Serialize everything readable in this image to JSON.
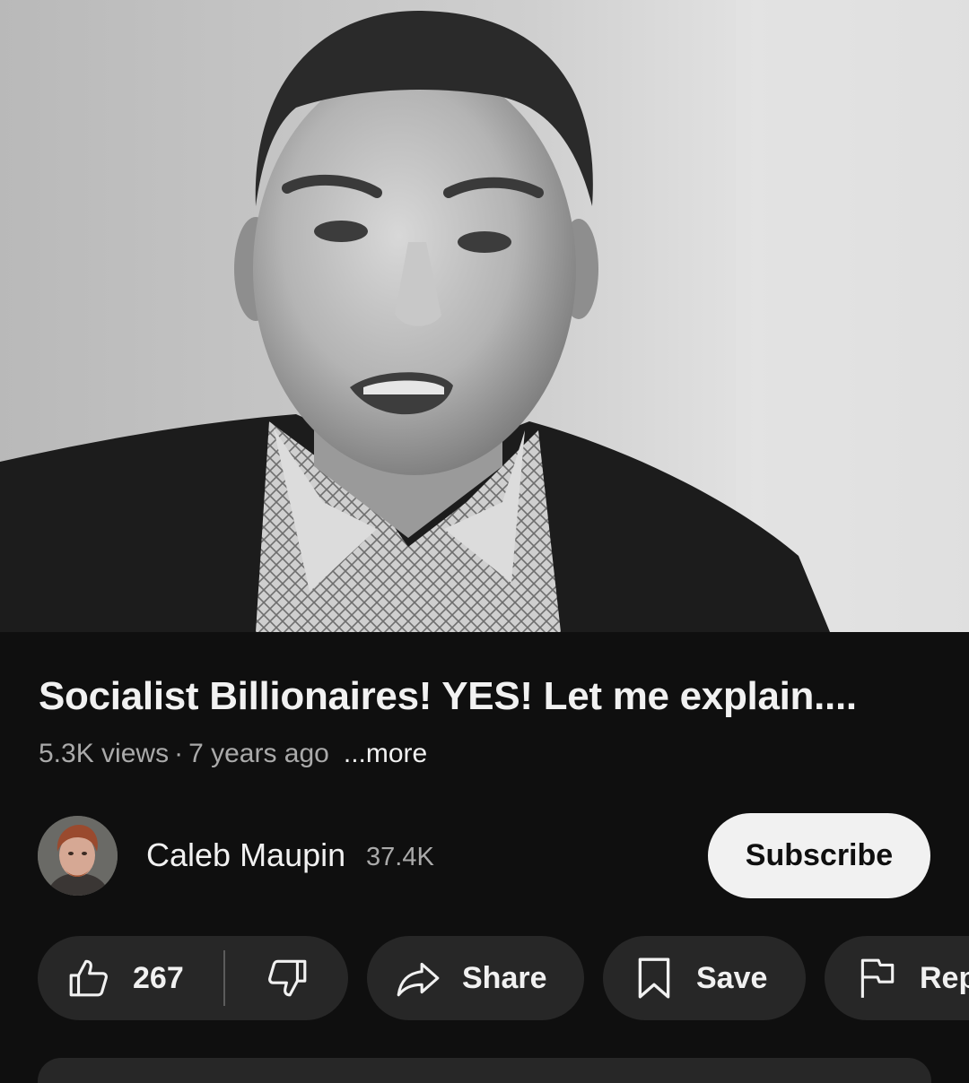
{
  "video": {
    "title": "Socialist Billionaires! YES! Let me explain....",
    "views": "5.3K views",
    "separator": "·",
    "age": "7 years ago",
    "more_label": "...more"
  },
  "channel": {
    "name": "Caleb Maupin",
    "subscribers": "37.4K",
    "subscribe_label": "Subscribe"
  },
  "actions": {
    "like_count": "267",
    "share_label": "Share",
    "save_label": "Save",
    "report_label": "Report"
  },
  "icons": {
    "like": "thumbs-up-icon",
    "dislike": "thumbs-down-icon",
    "share": "share-arrow-icon",
    "save": "bookmark-icon",
    "report": "flag-icon"
  },
  "colors": {
    "background": "#0f0f0f",
    "pill": "#272727",
    "text_primary": "#f1f1f1",
    "text_secondary": "#aaaaaa",
    "subscribe_bg": "#f1f1f1"
  }
}
